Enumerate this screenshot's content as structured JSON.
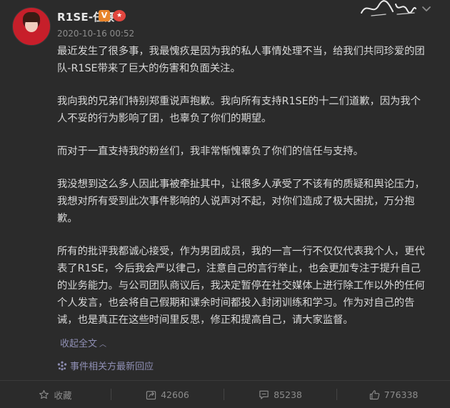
{
  "post": {
    "username": "R1SE-任豪",
    "badge_v": "V",
    "timestamp": "2020-10-16 00:52",
    "paragraphs": [
      "最近发生了很多事，我最愧疚是因为我的私人事情处理不当，给我们共同珍爱的团队-R1SE带来了巨大的伤害和负面关注。",
      "我向我的兄弟们特别郑重说声抱歉。我向所有支持R1SE的十二们道歉，因为我个人不妥的行为影响了团，也辜负了你们的期望。",
      "而对于一直支持我的粉丝们，我非常惭愧辜负了你们的信任与支持。",
      "我没想到这么多人因此事被牵扯其中，让很多人承受了不该有的质疑和舆论压力，我想对所有受到此次事件影响的人说声对不起，对你们造成了极大困扰，万分抱歉。",
      "所有的批评我都诚心接受，作为男团成员，我的一言一行不仅仅代表我个人，更代表了R1SE，今后我会严以律己，注意自己的言行举止，也会更加专注于提升自己的业务能力。与公司团队商议后，我决定暂停在社交媒体上进行除工作以外的任何个人发言，也会将自己假期和课余时间都投入封闭训练和学习。作为对自己的告诫，也是真正在这些时间里反思，修正和提高自己，请大家监督。"
    ],
    "collapse_label": "收起全文",
    "related_label": "事件相关方最新回应"
  },
  "actions": {
    "favorite": "收藏",
    "share_count": "42606",
    "comment_count": "85238",
    "like_count": "776338"
  },
  "colors": {
    "background": "#2b2b2b",
    "text": "#d9d9d9",
    "muted": "#8c8c8c",
    "link": "#8f8fb4",
    "badge_orange": "#e8852c"
  }
}
